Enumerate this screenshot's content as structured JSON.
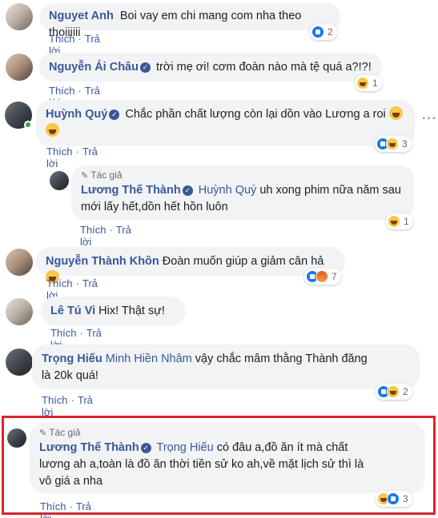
{
  "actions": {
    "like": "Thích",
    "reply": "Trả lời",
    "sep": "·"
  },
  "author_tag": "Tác giả",
  "comments": [
    {
      "name": "Nguyet Anh",
      "text": "Boi vay em chi mang com nha theo thoiiiiii",
      "reaction_count": "2"
    },
    {
      "name": "Nguyễn Ái Châu",
      "text": "trời mẹ ơi! cơm đoàn nào mà tệ quá a?!?!",
      "reaction_count": "1"
    },
    {
      "name": "Huỳnh Quý",
      "text": "Chắc phần chất lượng còn lại dồn vào Lương a roi",
      "reaction_count": "3"
    },
    {
      "name": "Lương Thế Thành",
      "mention": "Huỳnh Quý",
      "text_line1": "uh xong phim nữa năm sau",
      "text_line2": "mới lấy hết,dồn hết hồn luôn",
      "reaction_count": "1"
    },
    {
      "name": "Nguyễn Thành Khôn",
      "text": "Đoàn muốn giúp a giảm cân hả",
      "reaction_count": "7"
    },
    {
      "name": "Lê Tú Vi",
      "text": "Hix! Thật sự!",
      "reaction_count": ""
    },
    {
      "name": "Trọng Hiếu",
      "mention": "Minh Hiền Nhâm",
      "text_line1": "vậy chắc mâm thằng Thành đăng",
      "text_line2": "là 20k quá!",
      "reaction_count": "2"
    },
    {
      "name": "Lương Thế Thành",
      "mention": "Trọng Hiếu",
      "text_line1": "có đâu a,đồ ăn ít mà chất",
      "text_line2": "lương ah a,toàn là đồ ăn thời tiền sử ko ah,về mặt lịch sử thì là",
      "text_line3": "vô giá a nha",
      "reaction_count": "3"
    }
  ],
  "more_menu": "···",
  "colors": {
    "name": "#385898",
    "bubble": "#f2f3f5",
    "highlight": "#d9262c"
  }
}
